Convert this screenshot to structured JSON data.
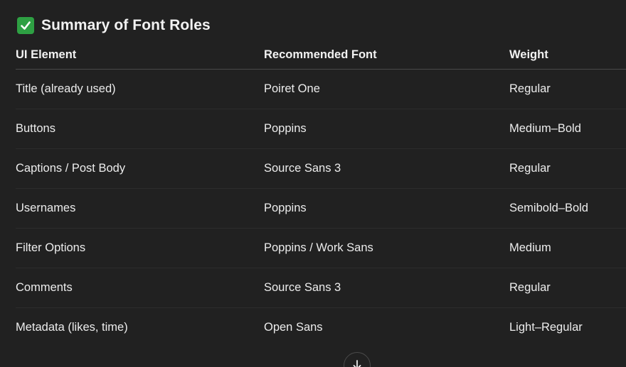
{
  "heading": {
    "icon": "check-mark-icon",
    "icon_color": "#2ea043",
    "title": "Summary of Font Roles"
  },
  "table": {
    "headers": [
      "UI Element",
      "Recommended Font",
      "Weight"
    ],
    "rows": [
      [
        "Title (already used)",
        "Poiret One",
        "Regular"
      ],
      [
        "Buttons",
        "Poppins",
        "Medium–Bold"
      ],
      [
        "Captions / Post Body",
        "Source Sans 3",
        "Regular"
      ],
      [
        "Usernames",
        "Poppins",
        "Semibold–Bold"
      ],
      [
        "Filter Options",
        "Poppins / Work Sans",
        "Medium"
      ],
      [
        "Comments",
        "Source Sans 3",
        "Regular"
      ],
      [
        "Metadata (likes, time)",
        "Open Sans",
        "Light–Regular"
      ]
    ]
  },
  "scroll_button": {
    "icon": "arrow-down-icon"
  }
}
